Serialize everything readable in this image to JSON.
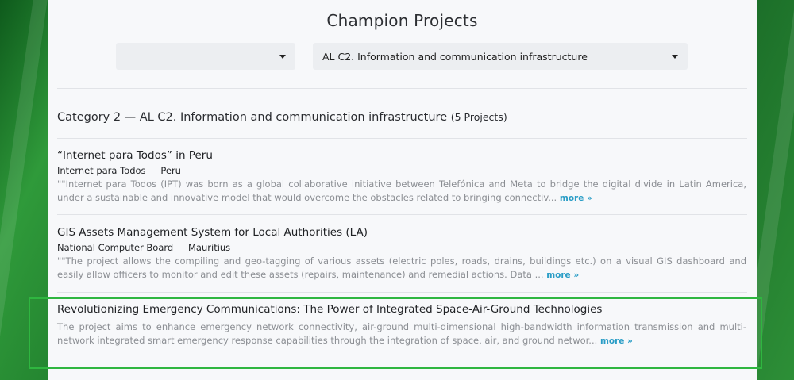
{
  "page": {
    "title": "Champion Projects"
  },
  "filters": {
    "first_dropdown_value": "",
    "category_dropdown_value": "AL C2. Information and communication infrastructure"
  },
  "category": {
    "heading": "Category 2 — AL C2. Information and communication infrastructure",
    "count": "(5 Projects)"
  },
  "projects": [
    {
      "title": "“Internet para Todos” in Peru",
      "org": "Internet para Todos — Peru",
      "desc": "\"\"Internet para Todos (IPT) was born as a global collaborative initiative between Telefónica and Meta to bridge the digital divide in Latin America, under a sustainable and innovative model that would overcome the obstacles related to bringing connectiv...",
      "more": "more »"
    },
    {
      "title": "GIS Assets Management System for Local Authorities (LA)",
      "org": "National Computer Board — Mauritius",
      "desc": "\"\"The project allows the compiling and geo-tagging of various assets (electric poles, roads, drains, buildings etc.) on a visual GIS dashboard and easily allow officers to monitor and edit these assets (repairs, maintenance) and remedial actions. Data ...",
      "more": "more »"
    },
    {
      "title": "Revolutionizing Emergency Communications: The Power of Integrated Space-Air-Ground Technologies",
      "org": "",
      "desc": "The project aims to enhance emergency network connectivity, air-ground multi-dimensional high-bandwidth information transmission and multi-network integrated smart emergency response capabilities through the integration of space, air, and ground networ...",
      "more": "more »"
    }
  ],
  "colors": {
    "accent_link": "#2a9dc6",
    "highlight_border": "#2fb640",
    "background_green": "#2f9a3a"
  }
}
